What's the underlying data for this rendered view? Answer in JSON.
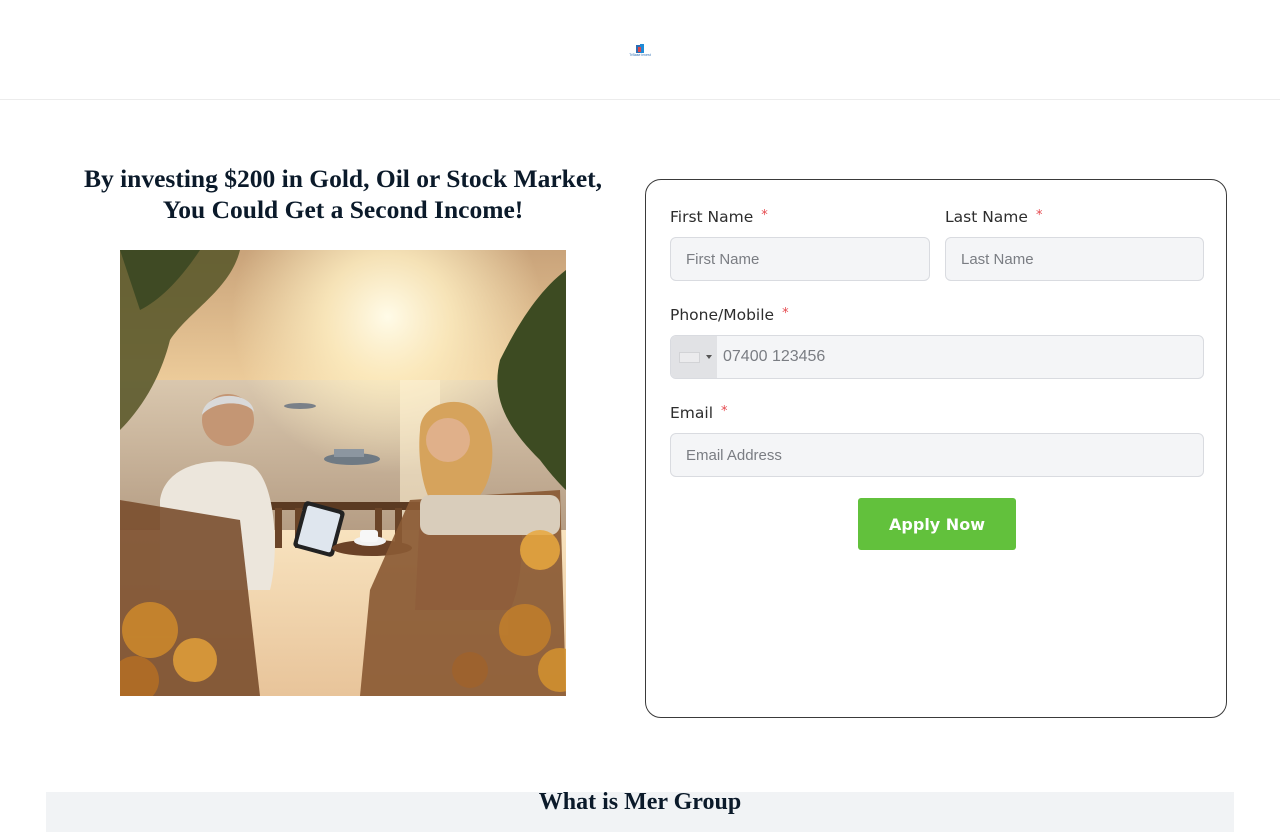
{
  "header": {
    "logo_text": "TrBase Invest"
  },
  "hero": {
    "headline_line1": "By investing $200 in Gold, Oil or Stock Market,",
    "headline_line2": "You Could Get a Second Income!"
  },
  "form": {
    "first_name_label": "First Name",
    "first_name_placeholder": "First Name",
    "last_name_label": "Last Name",
    "last_name_placeholder": "Last Name",
    "phone_label": "Phone/Mobile",
    "phone_placeholder": "07400 123456",
    "email_label": "Email",
    "email_placeholder": "Email Address",
    "required_marker": "*",
    "submit_label": "Apply Now"
  },
  "next_section": {
    "heading": "What is Mer Group"
  },
  "colors": {
    "accent_green": "#62c13c",
    "required_red": "#e5484d",
    "headline": "#0b1a2a"
  }
}
